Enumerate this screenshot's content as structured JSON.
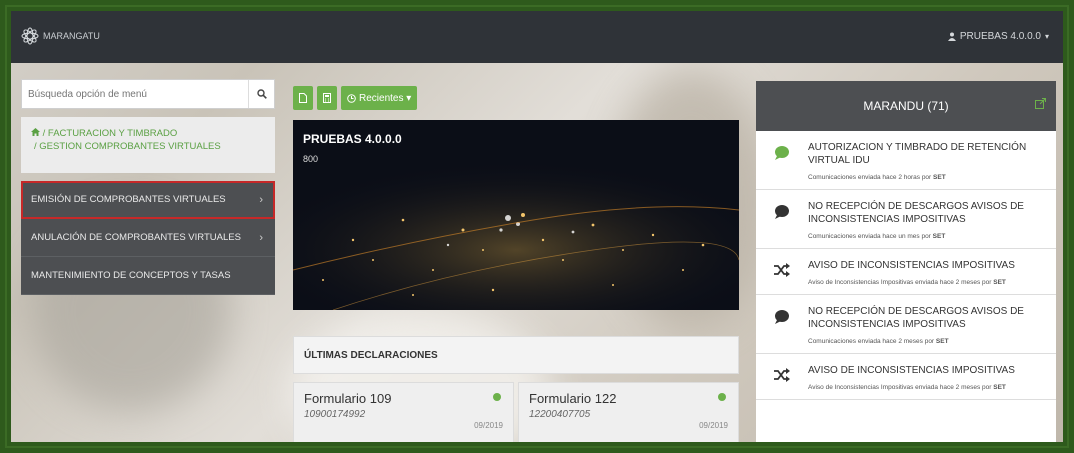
{
  "brand": {
    "name": "MARANGATU"
  },
  "user": {
    "label": "PRUEBAS 4.0.0.0",
    "caret": "▾"
  },
  "search": {
    "placeholder": "Búsqueda opción de menú"
  },
  "breadcrumb": {
    "line1": "/ FACTURACION Y TIMBRADO",
    "line2": "/ GESTION COMPROBANTES VIRTUALES"
  },
  "menu": {
    "items": [
      {
        "label": "EMISIÓN DE COMPROBANTES VIRTUALES",
        "chevron": "›"
      },
      {
        "label": "ANULACIÓN DE COMPROBANTES VIRTUALES",
        "chevron": "›"
      },
      {
        "label": "MANTENIMIENTO DE CONCEPTOS Y TASAS",
        "chevron": ""
      }
    ]
  },
  "toolbar": {
    "recientes_label": "Recientes ▾"
  },
  "banner": {
    "title": "PRUEBAS 4.0.0.0",
    "subtitle": "800"
  },
  "declaraciones": {
    "title": "ÚLTIMAS DECLARACIONES",
    "cards": [
      {
        "title": "Formulario 109",
        "number": "10900174992",
        "date": "09/2019"
      },
      {
        "title": "Formulario 122",
        "number": "12200407705",
        "date": "09/2019"
      }
    ]
  },
  "marandu": {
    "title": "MARANDU (71)",
    "items": [
      {
        "icon": "chat-bubble-green-icon",
        "title": "AUTORIZACION Y TIMBRADO DE RETENCIÓN VIRTUAL IDU",
        "sub": "Comunicaciones enviada hace 2 horas por",
        "by": "SET"
      },
      {
        "icon": "chat-bubble-icon",
        "title": "NO RECEPCIÓN DE DESCARGOS AVISOS DE INCONSISTENCIAS IMPOSITIVAS",
        "sub": "Comunicaciones enviada hace un mes por",
        "by": "SET"
      },
      {
        "icon": "shuffle-icon",
        "title": "AVISO DE INCONSISTENCIAS IMPOSITIVAS",
        "sub": "Aviso de Inconsistencias Impositivas enviada hace 2 meses por",
        "by": "SET"
      },
      {
        "icon": "chat-bubble-icon",
        "title": "NO RECEPCIÓN DE DESCARGOS AVISOS DE INCONSISTENCIAS IMPOSITIVAS",
        "sub": "Comunicaciones enviada hace 2 meses por",
        "by": "SET"
      },
      {
        "icon": "shuffle-icon",
        "title": "AVISO DE INCONSISTENCIAS IMPOSITIVAS",
        "sub": "Aviso de Inconsistencias Impositivas enviada hace 2 meses por",
        "by": "SET"
      }
    ]
  },
  "colors": {
    "accent": "#6cb14a",
    "dark": "#2f3338",
    "menu": "#4d4f52",
    "highlight": "#c62828"
  }
}
